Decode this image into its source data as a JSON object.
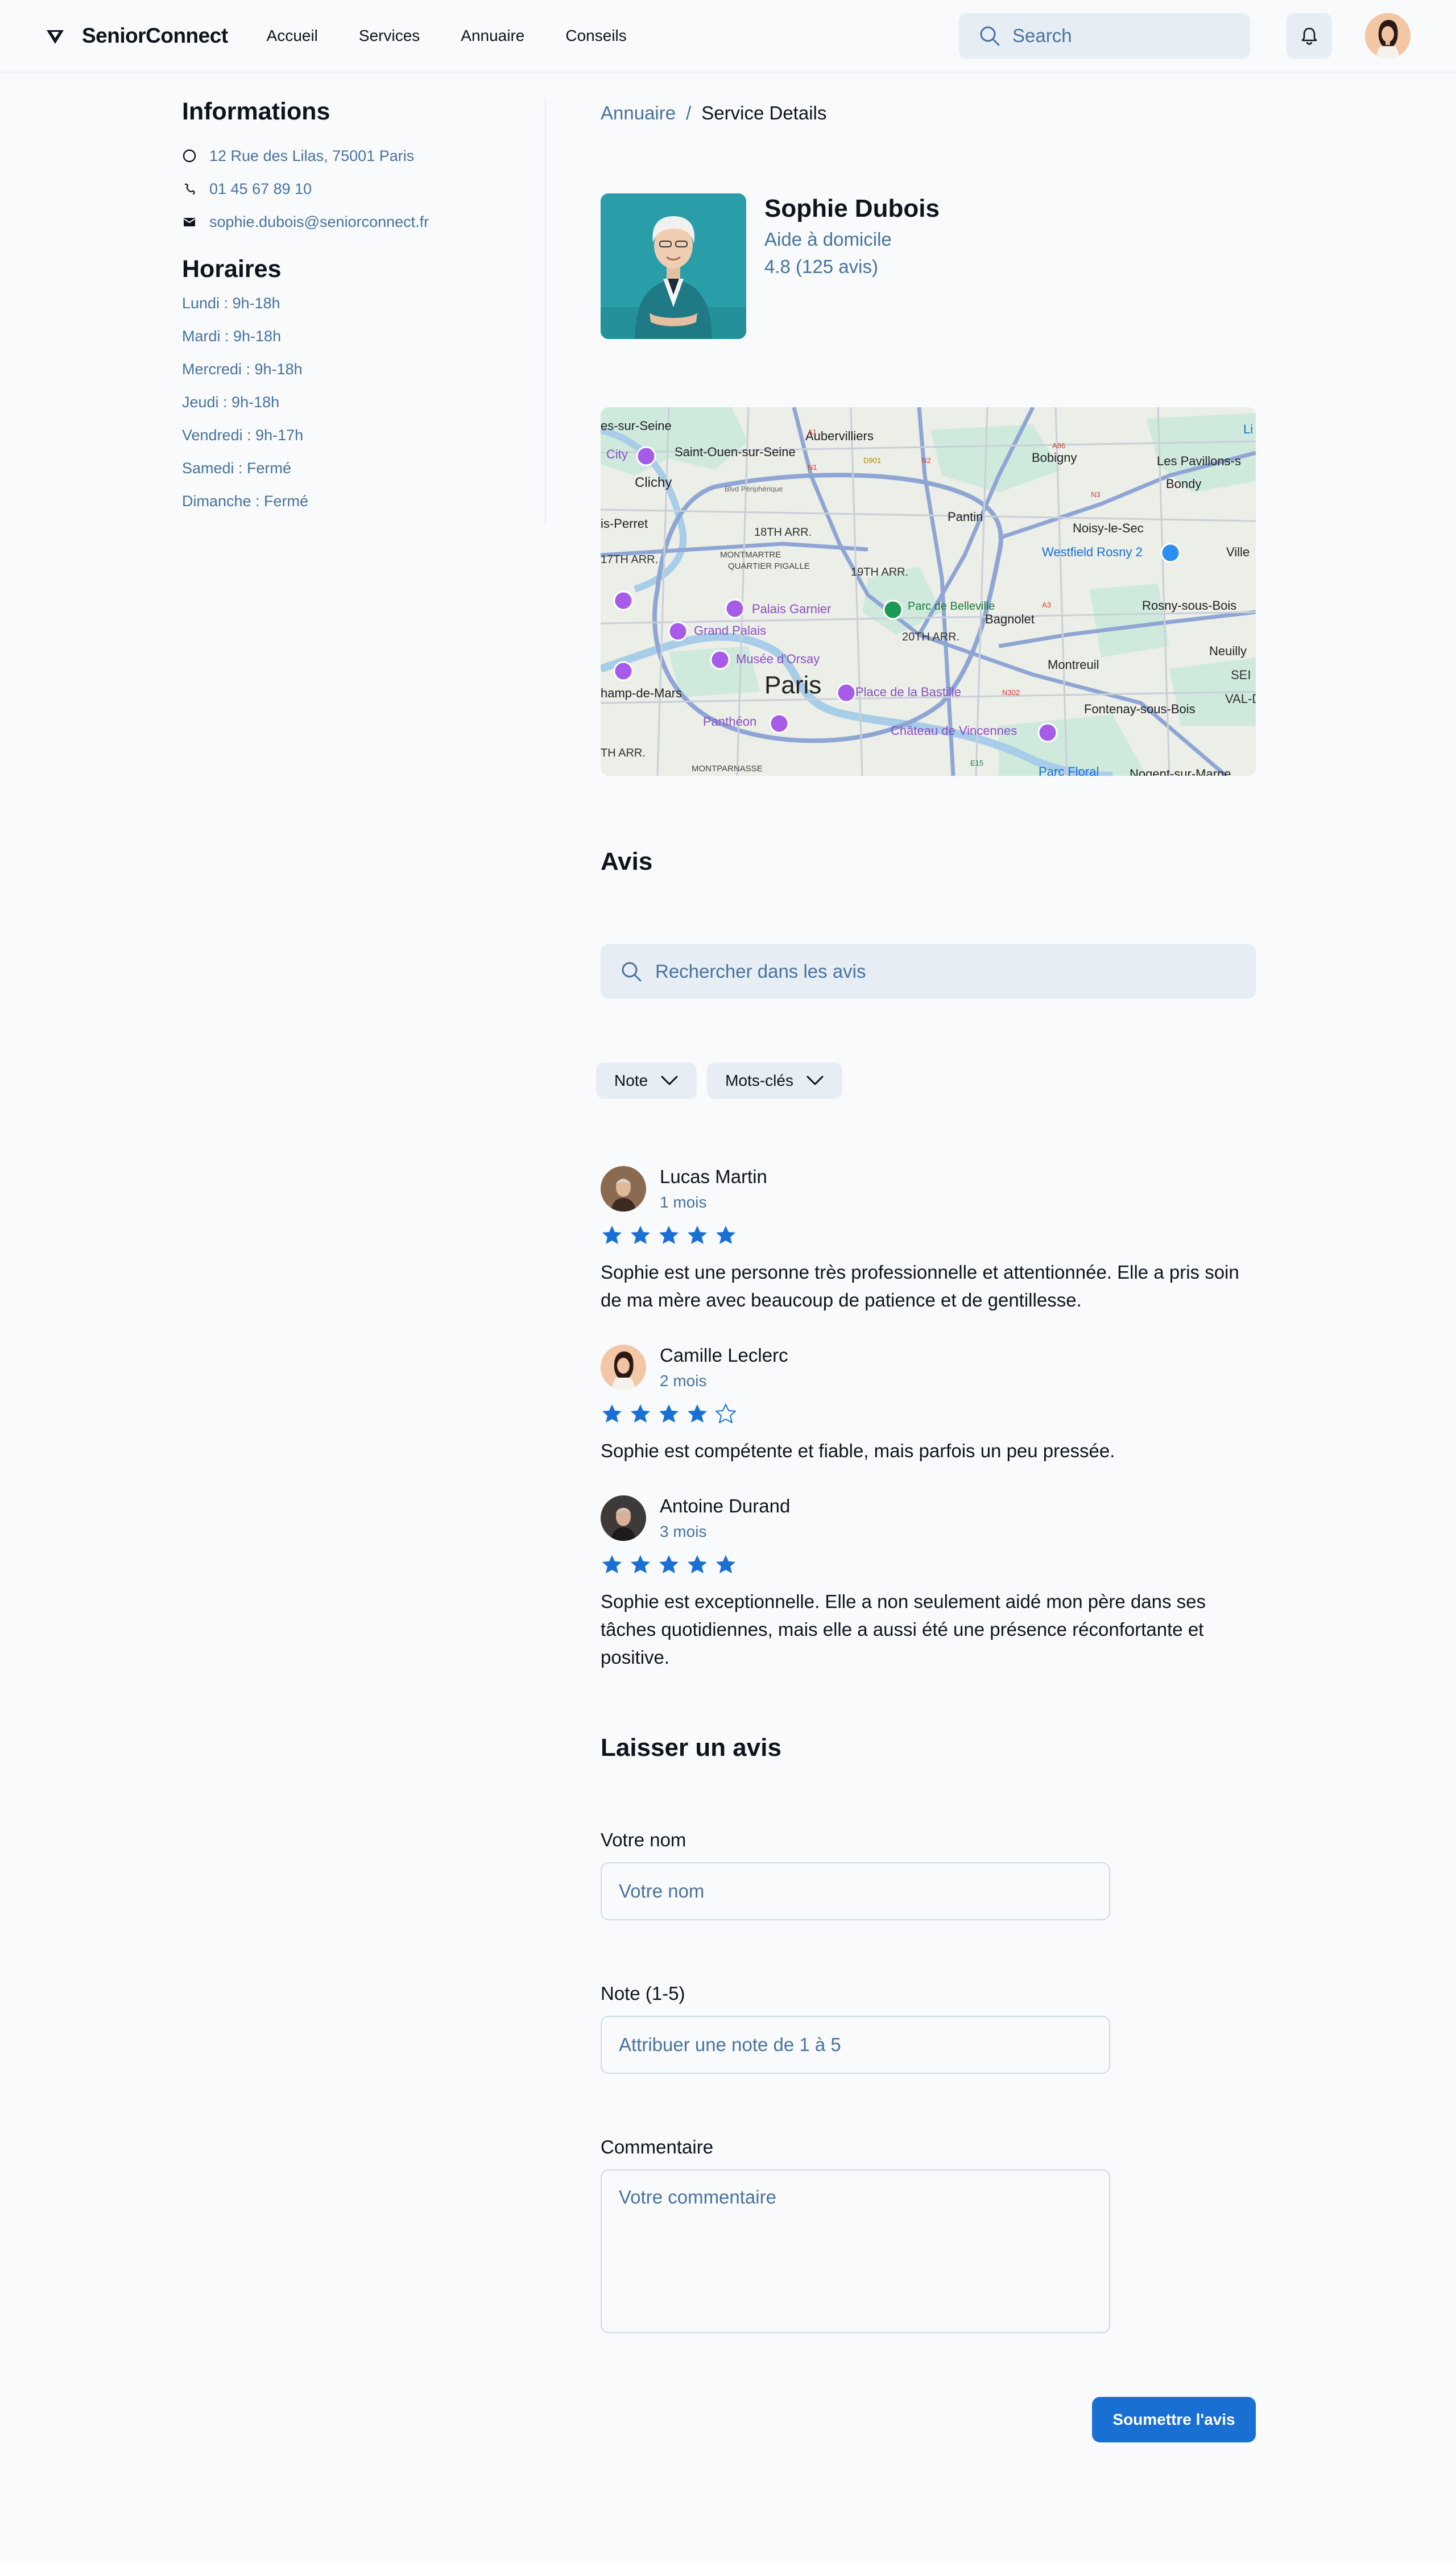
{
  "header": {
    "brand": "SeniorConnect",
    "nav": [
      "Accueil",
      "Services",
      "Annuaire",
      "Conseils"
    ],
    "search_placeholder": "Search"
  },
  "sidebar": {
    "info_title": "Informations",
    "address": "12 Rue des Lilas, 75001 Paris",
    "phone": "01 45 67 89 10",
    "email": "sophie.dubois@seniorconnect.fr",
    "hours_title": "Horaires",
    "hours": [
      "Lundi : 9h-18h",
      "Mardi : 9h-18h",
      "Mercredi : 9h-18h",
      "Jeudi : 9h-18h",
      "Vendredi : 9h-17h",
      "Samedi : Fermé",
      "Dimanche : Fermé"
    ]
  },
  "breadcrumb": {
    "parent": "Annuaire",
    "separator": "/",
    "current": "Service Details"
  },
  "profile": {
    "name": "Sophie Dubois",
    "role": "Aide à domicile",
    "rating": "4.8 (125 avis)"
  },
  "map": {
    "labels": [
      "es-sur-Seine",
      "Saint-Ouen-sur-Seine",
      "Aubervilliers",
      "Bobigny",
      "Les Pavillons-s",
      "Bondy",
      "Clichy",
      "Pantin",
      "Noisy-le-Sec",
      "is-Perret",
      "18TH ARR.",
      "17TH ARR.",
      "MONTMARTRE",
      "19TH ARR.",
      "Westfield Rosny 2",
      "Ville",
      "QUARTIER PIGALLE",
      "Palais Garnier",
      "Parc de Belleville",
      "Bagnolet",
      "Rosny-sous-Bois",
      "Grand Palais",
      "20TH ARR.",
      "Musée d'Orsay",
      "Montreuil",
      "Neuilly",
      "Paris",
      "Place de la Bastille",
      "hamp-de-Mars",
      "Panthéon",
      "Château de Vincennes",
      "Fontenay-sous-Bois",
      "TH ARR.",
      "MONTPARNASSE",
      "Parc Floral",
      "Nogent-sur-Marne",
      "City",
      "Blvd Périphérique",
      "A1",
      "A86",
      "A3",
      "N1",
      "D901",
      "N2",
      "N3",
      "N302",
      "E15",
      "Li",
      "SEI",
      "VAL-D"
    ]
  },
  "reviews": {
    "title": "Avis",
    "search_placeholder": "Rechercher dans les avis",
    "filters": [
      "Note",
      "Mots-clés"
    ],
    "items": [
      {
        "name": "Lucas Martin",
        "time": "1 mois",
        "rating": 5,
        "text": "Sophie est une personne très professionnelle et attentionnée. Elle a pris soin de ma mère avec beaucoup de patience et de gentillesse."
      },
      {
        "name": "Camille Leclerc",
        "time": "2 mois",
        "rating": 4,
        "text": "Sophie est compétente et fiable, mais parfois un peu pressée."
      },
      {
        "name": "Antoine Durand",
        "time": "3 mois",
        "rating": 5,
        "text": "Sophie est exceptionnelle. Elle a non seulement aidé mon père dans ses tâches quotidiennes, mais elle a aussi été une présence réconfortante et positive."
      }
    ]
  },
  "form": {
    "title": "Laisser un avis",
    "name_label": "Votre nom",
    "name_placeholder": "Votre nom",
    "note_label": "Note (1-5)",
    "note_placeholder": "Attribuer une note de 1 à 5",
    "comment_label": "Commentaire",
    "comment_placeholder": "Votre commentaire",
    "submit": "Soumettre l'avis"
  },
  "colors": {
    "accent": "#1a70d2",
    "muted": "#49739c",
    "surface": "#e7edf4",
    "background": "#f8fafc"
  }
}
